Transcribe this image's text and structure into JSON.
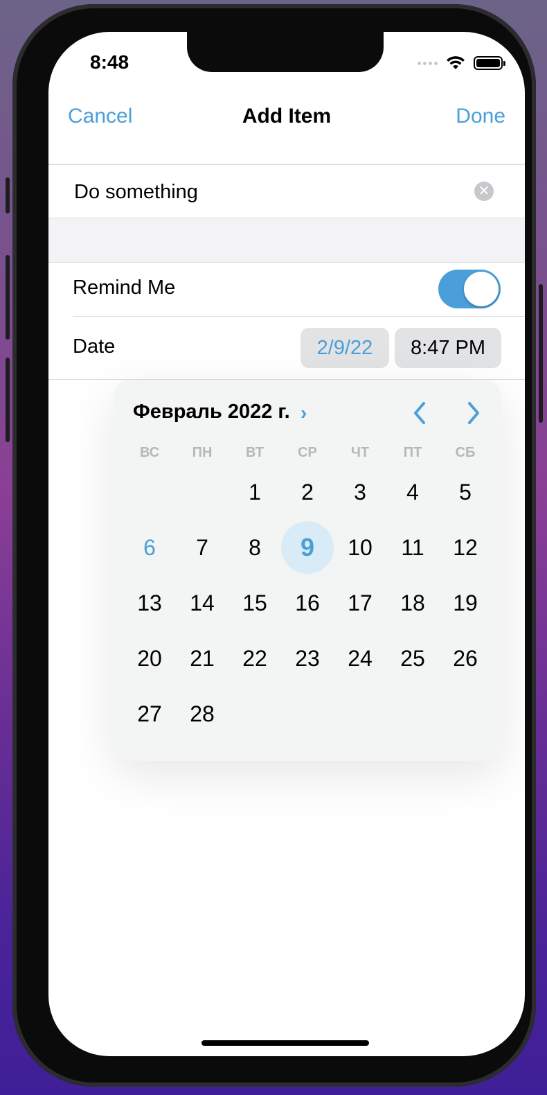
{
  "status_bar": {
    "time": "8:48"
  },
  "nav": {
    "cancel": "Cancel",
    "title": "Add Item",
    "done": "Done"
  },
  "form": {
    "title_value": "Do something",
    "remind_label": "Remind Me",
    "remind_on": true,
    "date_label": "Date",
    "date_value": "2/9/22",
    "time_value": "8:47 PM"
  },
  "calendar": {
    "month_label": "Февраль 2022 г.",
    "weekdays": [
      "ВС",
      "ПН",
      "ВТ",
      "СР",
      "ЧТ",
      "ПТ",
      "СБ"
    ],
    "first_weekday_index": 2,
    "days_in_month": 28,
    "today": 6,
    "selected": 9
  },
  "colors": {
    "accent": "#4a9fd9",
    "selected_bg": "#d9ebf7"
  },
  "icons": {
    "clear": "clear-text-icon",
    "month_chevron": "chevron-right-icon",
    "prev": "chevron-left-icon",
    "next": "chevron-right-icon"
  }
}
